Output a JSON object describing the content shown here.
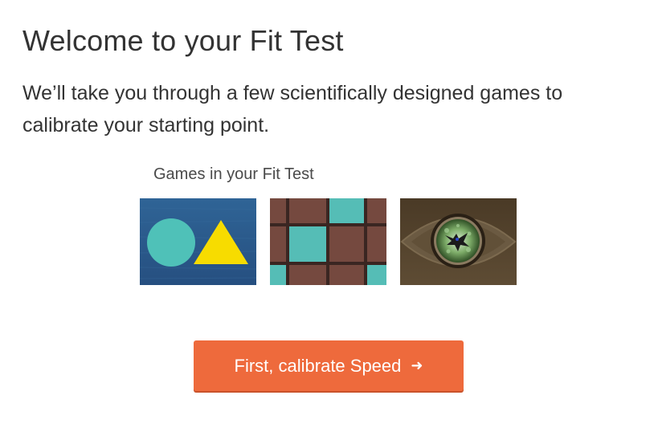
{
  "heading": {
    "title": "Welcome to your Fit Test",
    "intro": "We’ll take you through a few scientifically designed games to calibrate your starting point."
  },
  "games": {
    "label": "Games in your Fit Test",
    "thumbnails": [
      {
        "icon": "circle-triangle-icon",
        "background": "#2c5a8c"
      },
      {
        "icon": "grid-tiles-icon",
        "background": "#6e473f"
      },
      {
        "icon": "eye-bird-icon",
        "background": "#5c4b34"
      }
    ]
  },
  "cta": {
    "label": "First, calibrate Speed",
    "arrow": "➜",
    "color": "#ee6a3c"
  }
}
